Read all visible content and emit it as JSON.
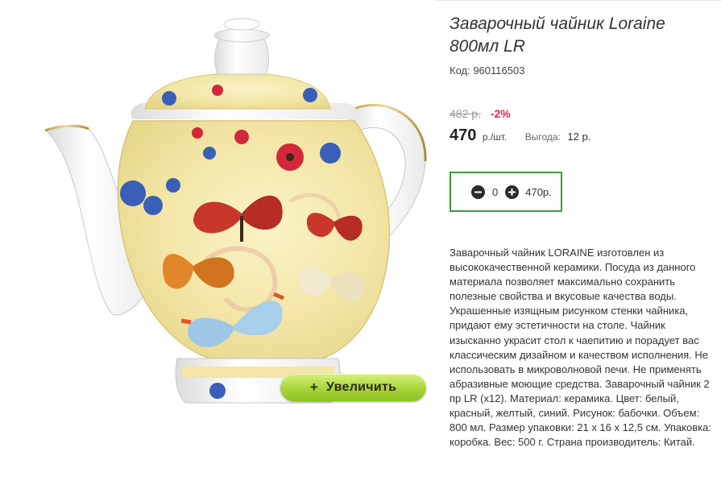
{
  "product": {
    "title": "Заварочный чайник Loraine 800мл LR",
    "code": "Код: 960116503",
    "old_price": "482 р.",
    "discount": "-2%",
    "price": "470",
    "price_unit": "р./шт.",
    "benefit_label": "Выгода:",
    "benefit_value": "12 р.",
    "image_alt_icon": "teapot-photo"
  },
  "cart": {
    "minus_icon": "minus-circle-icon",
    "plus_icon": "plus-circle-icon",
    "quantity": "0",
    "total": "470р."
  },
  "zoom": {
    "plus": "+",
    "label": "Увеличить"
  },
  "description": "Заварочный чайник LORAINE изготовлен из высококачественной керамики. Посуда из данного материала позволяет максимально сохранить полезные свойства и вкусовые качества воды. Украшенные изящным рисунком стенки чайника, придают ему эстетичности на столе. Чайник изысканно украсит стол к чаепитию и порадует вас классическим дизайном и качеством исполнения. Не использовать в микроволновой печи. Не применять абразивные моющие средства. Заварочный чайник 2 пр LR (х12). Материал: керамика. Цвет: белый, красный, желтый, синий. Рисунок: бабочки. Объем: 800 мл. Размер упаковки: 21 х 16 х 12,5 см. Упаковка: коробка. Вес: 500 г. Страна производитель: Китай.",
  "colors": {
    "accent_green": "#3d9a3d",
    "discount_red": "#e0284b",
    "zoom_button": "#a8d43a"
  }
}
